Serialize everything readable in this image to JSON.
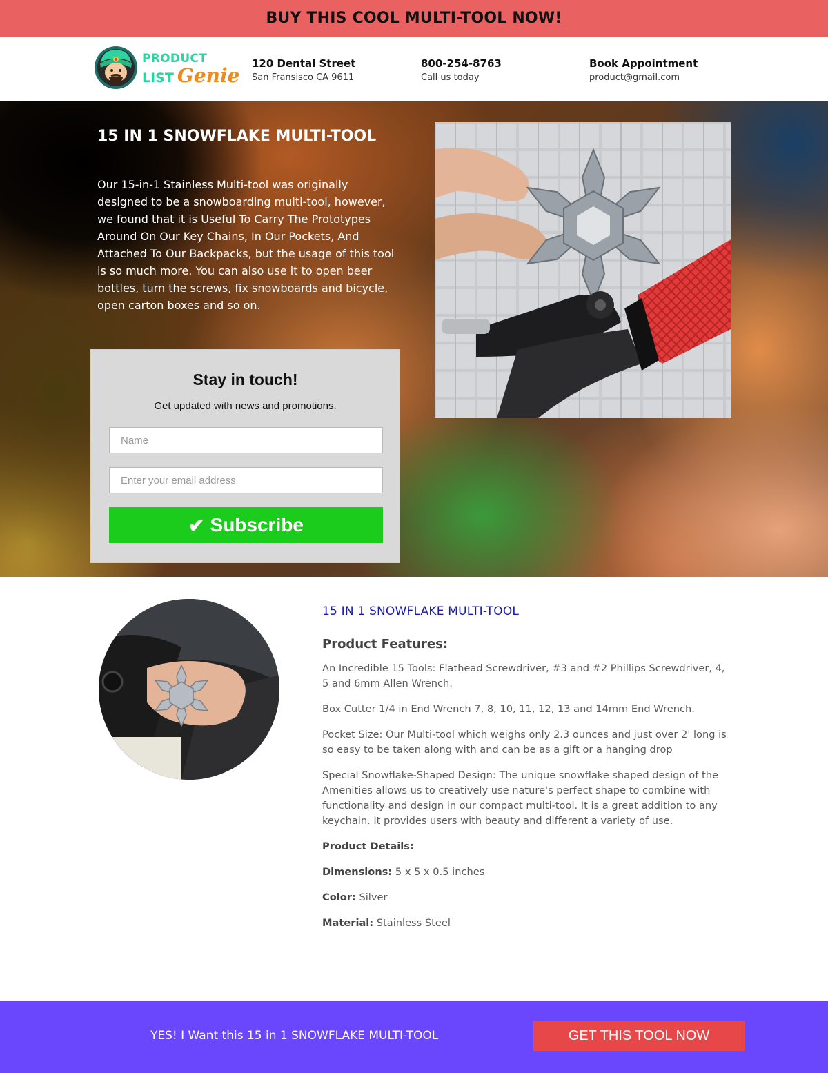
{
  "banner": {
    "text": "BUY THIS COOL MULTI-TOOL NOW!"
  },
  "logo": {
    "line1": "PRODUCT",
    "line2a": "LIST",
    "line2b": "Genie"
  },
  "header": {
    "address": {
      "title": "120 Dental Street",
      "sub": "San Fransisco CA 9611"
    },
    "phone": {
      "title": "800-254-8763",
      "sub": "Call us today"
    },
    "booking": {
      "title": "Book Appointment",
      "sub": "product@gmail.com"
    }
  },
  "hero": {
    "title": "15 IN 1 SNOWFLAKE MULTI-TOOL",
    "description": "Our 15-in-1 Stainless Multi-tool was originally designed to be a snowboarding multi-tool, however, we found that it is Useful To Carry The Prototypes Around On Our Key Chains, In Our Pockets, And Attached To Our Backpacks, but the usage of this tool is so much more. You can also use it to open beer bottles, turn the screws, fix snowboards and bicycle, open carton boxes and so on."
  },
  "signup": {
    "title": "Stay in touch!",
    "subtitle": "Get updated with news and promotions.",
    "name_placeholder": "Name",
    "email_placeholder": "Enter your email address",
    "button_check": "✔",
    "button_label": "Subscribe"
  },
  "details": {
    "title": "15 IN 1 SNOWFLAKE MULTI-TOOL",
    "features_heading": "Product Features:",
    "features": [
      "An Incredible 15 Tools: Flathead Screwdriver, #3 and #2 Phillips Screwdriver, 4, 5 and 6mm Allen Wrench.",
      "Box Cutter 1/4 in End Wrench 7, 8, 10, 11, 12, 13 and 14mm End Wrench.",
      "Pocket Size: Our Multi-tool which weighs only 2.3 ounces and just over 2' long is so easy to be taken along with and can be as a gift or a hanging drop",
      "Special Snowflake-Shaped Design: The unique snowflake shaped design of the Amenities allows us to creatively use nature's perfect shape to combine with functionality and design in our compact multi-tool. It is a great addition to any keychain. It provides users with beauty and different a variety of use."
    ],
    "product_details_heading": "Product Details:",
    "dimensions_label": "Dimensions:",
    "dimensions_value": "5 x 5 x 0.5 inches",
    "color_label": "Color:",
    "color_value": "Silver",
    "material_label": "Material:",
    "material_value": "Stainless Steel"
  },
  "cta": {
    "text": "YES! I Want this 15 in 1 SNOWFLAKE MULTI-TOOL",
    "button": "GET THIS TOOL NOW"
  },
  "colors": {
    "banner": "#ea6161",
    "subscribe": "#1ccc1c",
    "cta_bar": "#6a47fc",
    "cta_button": "#e8474a",
    "details_title": "#1a1aa6"
  },
  "icons": {
    "logo": "genie-mascot-icon",
    "checkmark": "checkmark-icon",
    "hero_photo": "snowflake-multitool-on-bicycle",
    "circle_photo": "hand-holding-multitool"
  }
}
